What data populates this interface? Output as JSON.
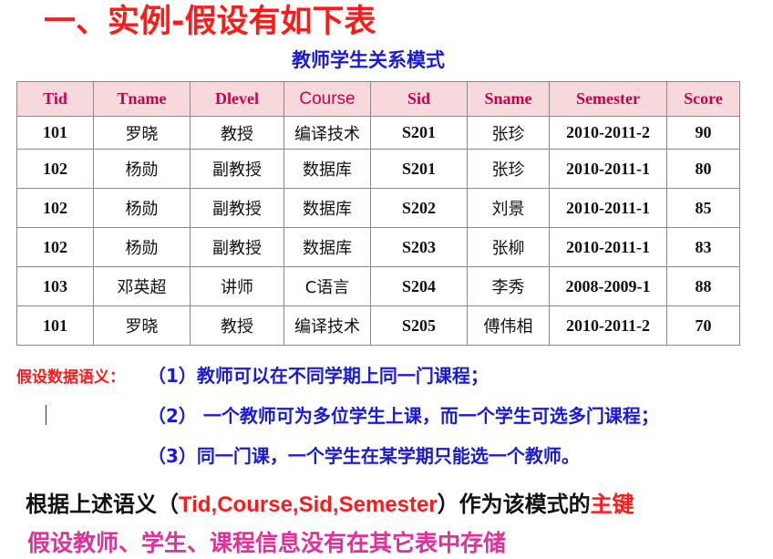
{
  "title": "一、实例-假设有如下表",
  "table_caption": "教师学生关系模式",
  "table": {
    "headers": [
      "Tid",
      "Tname",
      "Dlevel",
      "Course",
      "Sid",
      "Sname",
      "Semester",
      "Score"
    ],
    "rows": [
      [
        "101",
        "罗晓",
        "教授",
        "编译技术",
        "S201",
        "张珍",
        "2010-2011-2",
        "90"
      ],
      [
        "102",
        "杨勋",
        "副教授",
        "数据库",
        "S201",
        "张珍",
        "2010-2011-1",
        "80"
      ],
      [
        "102",
        "杨勋",
        "副教授",
        "数据库",
        "S202",
        "刘景",
        "2010-2011-1",
        "85"
      ],
      [
        "102",
        "杨勋",
        "副教授",
        "数据库",
        "S203",
        "张柳",
        "2010-2011-1",
        "83"
      ],
      [
        "103",
        "邓英超",
        "讲师",
        "C语言",
        "S204",
        "李秀",
        "2008-2009-1",
        "88"
      ],
      [
        "101",
        "罗晓",
        "教授",
        "编译技术",
        "S205",
        "傅伟相",
        "2010-2011-2",
        "70"
      ]
    ]
  },
  "semantics": {
    "label": "假设数据语义：",
    "items": [
      "（1）教师可以在不同学期上同一门课程；",
      "（2） 一个教师可为多位学生上课，而一个学生可选多门课程；",
      "（3）同一门课，一个学生在某学期只能选一个教师。"
    ]
  },
  "primary_key": {
    "prefix": "根据上述语义（",
    "attrs": "Tid,Course,Sid,Semester",
    "middle": "）作为该模式的",
    "key_word": "主键"
  },
  "note": "假设教师、学生、课程信息没有在其它表中存储",
  "colors": {
    "title": "#ff1a1a",
    "caption": "#1a1ad9",
    "header_bg": "#f7d9dc",
    "header_text": "#c8004f",
    "semantics_text": "#1a1ad9",
    "note": "#e0309a"
  }
}
